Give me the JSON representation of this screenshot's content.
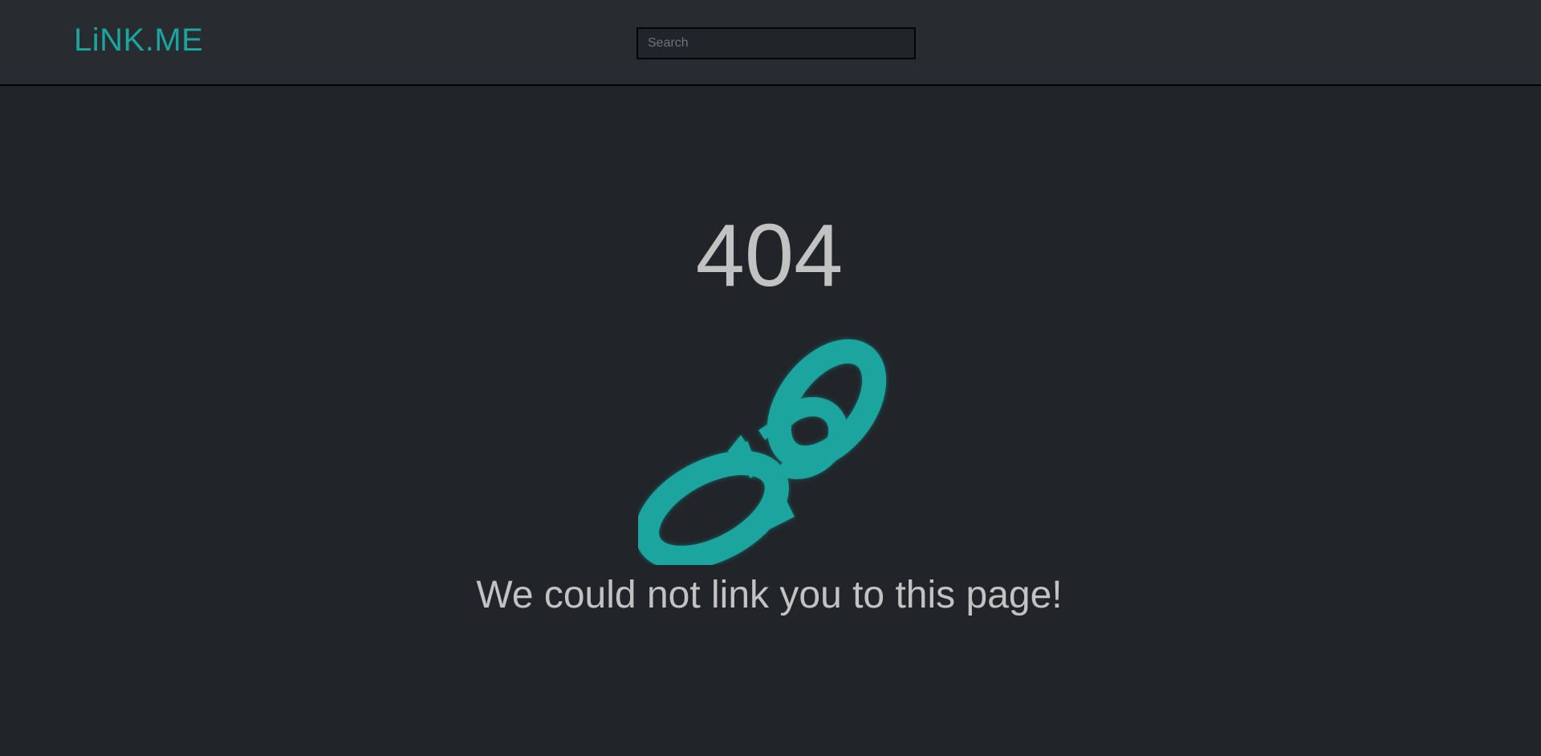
{
  "header": {
    "logo_text": "LiNK.ME",
    "search": {
      "placeholder": "Search",
      "value": ""
    }
  },
  "main": {
    "error_code": "404",
    "icon": "broken-chain-link-icon",
    "message": "We could not link you to this page!"
  },
  "colors": {
    "background": "#212429",
    "header_background": "#282b30",
    "accent": "#1aa59f",
    "text": "#c2c2c2"
  }
}
